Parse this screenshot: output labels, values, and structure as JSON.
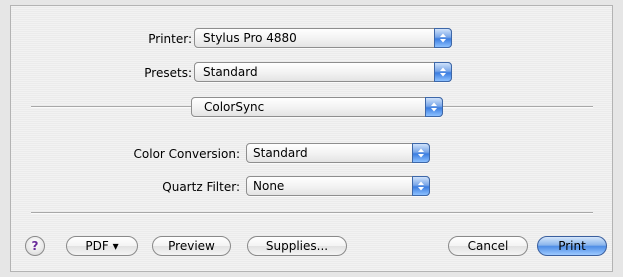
{
  "dialog": {
    "printer": {
      "label": "Printer:",
      "value": "Stylus Pro 4880"
    },
    "presets": {
      "label": "Presets:",
      "value": "Standard"
    },
    "panel": {
      "value": "ColorSync"
    },
    "color_conversion": {
      "label": "Color Conversion:",
      "value": "Standard"
    },
    "quartz_filter": {
      "label": "Quartz Filter:",
      "value": "None"
    }
  },
  "buttons": {
    "help": "?",
    "pdf": "PDF ▾",
    "preview": "Preview",
    "supplies": "Supplies...",
    "cancel": "Cancel",
    "print": "Print"
  },
  "icons": {
    "popup_arrows": "up-down-arrows-icon",
    "help": "question-mark-icon"
  },
  "colors": {
    "default_button": "#4e8de6",
    "popup_arrow_bg": "#3b7de0",
    "help_glyph": "#6a2c9a"
  }
}
